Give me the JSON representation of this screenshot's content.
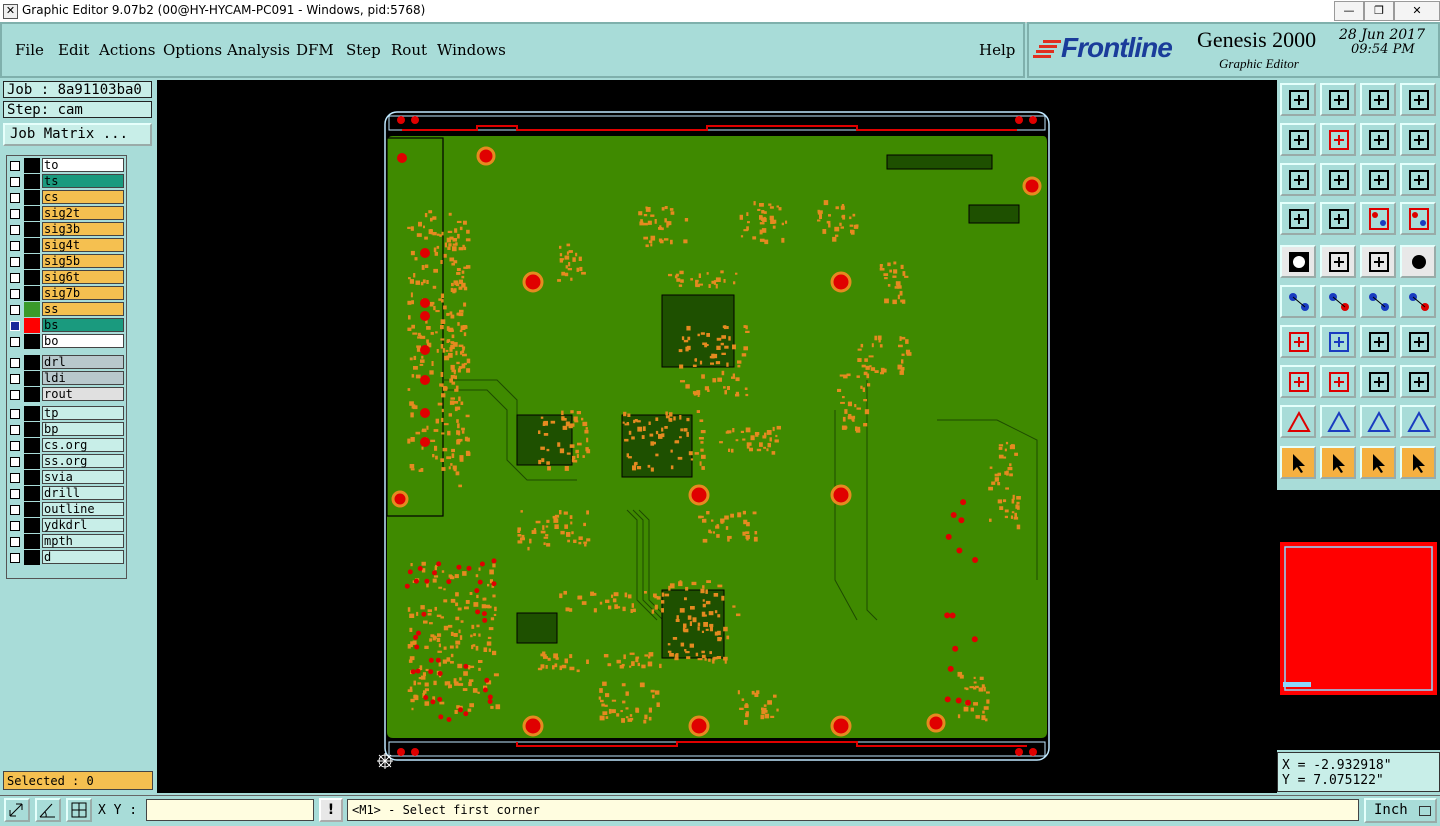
{
  "window": {
    "title": "Graphic Editor 9.07b2 (00@HY-HYCAM-PC091 - Windows, pid:5768)",
    "minimize": "—",
    "restore": "❐",
    "close": "✕"
  },
  "menu": [
    "File",
    "Edit",
    "Actions",
    "Options",
    "Analysis",
    "DFM",
    "Step",
    "Rout",
    "Windows"
  ],
  "help": "Help",
  "brand": {
    "logo": "Frontline",
    "product": "Genesis 2000",
    "subtitle": "Graphic Editor",
    "date": "28 Jun 2017",
    "time": "09:54 PM"
  },
  "job": {
    "job_label": "Job : 8a91103ba0",
    "step_label": "Step: cam",
    "matrix_button": "Job Matrix ..."
  },
  "layers": {
    "group1": [
      {
        "name": "to",
        "bg": "#ffffff",
        "swatch": "#000000"
      },
      {
        "name": "ts",
        "bg": "#1a9a7e",
        "swatch": "#000000"
      },
      {
        "name": "cs",
        "bg": "#f5c050",
        "swatch": "#000000"
      },
      {
        "name": "sig2t",
        "bg": "#f5c050",
        "swatch": "#000000"
      },
      {
        "name": "sig3b",
        "bg": "#f5c050",
        "swatch": "#000000"
      },
      {
        "name": "sig4t",
        "bg": "#f5c050",
        "swatch": "#000000"
      },
      {
        "name": "sig5b",
        "bg": "#f5c050",
        "swatch": "#000000"
      },
      {
        "name": "sig6t",
        "bg": "#f5c050",
        "swatch": "#000000"
      },
      {
        "name": "sig7b",
        "bg": "#f5c050",
        "swatch": "#000000"
      },
      {
        "name": "ss",
        "bg": "#f5c050",
        "swatch": "#3a9a2a"
      },
      {
        "name": "bs",
        "bg": "#1a9a7e",
        "swatch": "#ff0000"
      },
      {
        "name": "bo",
        "bg": "#ffffff",
        "swatch": "#000000"
      }
    ],
    "group2": [
      {
        "name": "drl",
        "bg": "#b8c8cc",
        "swatch": "#000000"
      },
      {
        "name": "ldi",
        "bg": "#b8c8cc",
        "swatch": "#000000"
      },
      {
        "name": "rout",
        "bg": "#e0e0e0",
        "swatch": "#000000"
      }
    ],
    "group3": [
      {
        "name": "tp",
        "bg": "#c8eee8",
        "swatch": "#000000"
      },
      {
        "name": "bp",
        "bg": "#c8eee8",
        "swatch": "#000000"
      },
      {
        "name": "cs.org",
        "bg": "#c8eee8",
        "swatch": "#000000"
      },
      {
        "name": "ss.org",
        "bg": "#c8eee8",
        "swatch": "#000000"
      },
      {
        "name": "svia",
        "bg": "#c8eee8",
        "swatch": "#000000"
      },
      {
        "name": "drill",
        "bg": "#c8eee8",
        "swatch": "#000000"
      },
      {
        "name": "outline",
        "bg": "#c8eee8",
        "swatch": "#000000"
      },
      {
        "name": "ydkdrl",
        "bg": "#c8eee8",
        "swatch": "#000000"
      },
      {
        "name": "mpth",
        "bg": "#c8eee8",
        "swatch": "#000000"
      },
      {
        "name": "d",
        "bg": "#c8eee8",
        "swatch": "#000000"
      }
    ]
  },
  "selected": "Selected : 0",
  "coords": {
    "x": "X = -2.932918\"",
    "y": "Y = 7.075122\""
  },
  "bottom": {
    "xy_label": "X Y :",
    "xy_value": "",
    "prompt": "<M1> - Select first corner",
    "units": "Inch"
  },
  "colors": {
    "board": "#3f8a00",
    "pad": "#e00000",
    "copper": "#e58a20",
    "outline": "#bfe8ff"
  }
}
